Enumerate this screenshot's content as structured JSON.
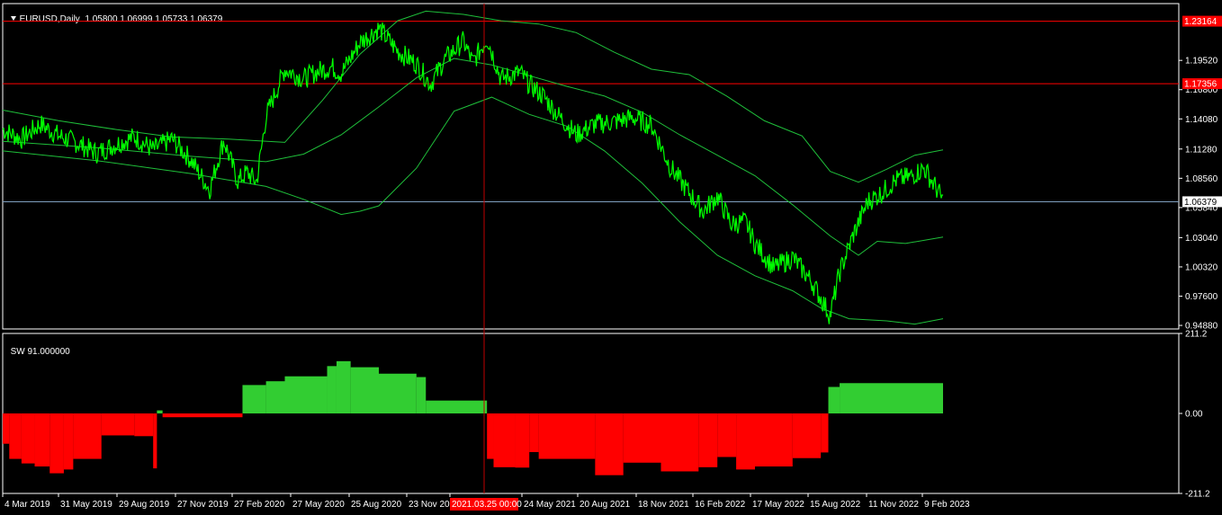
{
  "header": {
    "symbol": "EURUSD,Daily",
    "ohlc": "1.05800 1.06999 1.05733 1.06379",
    "indicator": "SW 91.000000"
  },
  "colors": {
    "background": "#000000",
    "price": "#00ff00",
    "bands": "#1fbf3a",
    "grid_frame": "#ffffff",
    "hline": "#ff0000",
    "positive": "#32cd32",
    "negative": "#ff0000",
    "crosshair": "#c00000",
    "current_price_line": "#7f9fbf"
  },
  "chart_data": [
    {
      "type": "line",
      "title": "EURUSD,Daily",
      "x_ticks": [
        "4 Mar 2019",
        "31 May 2019",
        "29 Aug 2019",
        "27 Nov 2019",
        "27 Feb 2020",
        "27 May 2020",
        "25 Aug 2020",
        "23 Nov 202",
        "2021.03.25 00:00",
        "24 May 2021",
        "20 Aug 2021",
        "18 Nov 2021",
        "16 Feb 2022",
        "17 May 2022",
        "15 Aug 2022",
        "11 Nov 2022",
        "9 Feb 2023"
      ],
      "y_ticks": [
        "1.19520",
        "1.16800",
        "1.14080",
        "1.11280",
        "1.08560",
        "1.05840",
        "1.03040",
        "1.00320",
        "0.97600",
        "0.94880"
      ],
      "ylim": [
        0.9455,
        1.248
      ],
      "h_levels": [
        {
          "label": "1.23164",
          "value": 1.23164
        },
        {
          "label": "1.17356",
          "value": 1.17356
        }
      ],
      "current_price": {
        "label": "1.06379",
        "value": 1.06379
      },
      "crosshair_date": "2021.03.25 00:00",
      "series": [
        {
          "role": "price",
          "x": [
            0,
            0.02,
            0.04,
            0.06,
            0.08,
            0.1,
            0.12,
            0.14,
            0.16,
            0.18,
            0.2,
            0.22,
            0.235,
            0.25,
            0.26,
            0.27,
            0.28,
            0.3,
            0.32,
            0.335,
            0.35,
            0.36,
            0.38,
            0.4,
            0.42,
            0.44,
            0.455,
            0.47,
            0.49,
            0.5,
            0.515,
            0.53,
            0.55,
            0.56,
            0.575,
            0.59,
            0.61,
            0.63,
            0.65,
            0.67,
            0.69,
            0.71,
            0.73,
            0.745,
            0.76,
            0.775,
            0.79,
            0.8,
            0.82,
            0.84,
            0.86,
            0.88,
            0.89,
            0.905,
            0.92,
            0.935,
            0.95,
            0.965,
            0.98,
            0.995,
            1.0
          ],
          "y": [
            1.131,
            1.122,
            1.136,
            1.125,
            1.118,
            1.109,
            1.117,
            1.124,
            1.112,
            1.122,
            1.103,
            1.075,
            1.121,
            1.083,
            1.091,
            1.082,
            1.143,
            1.187,
            1.178,
            1.185,
            1.189,
            1.183,
            1.212,
            1.225,
            1.204,
            1.192,
            1.173,
            1.196,
            1.213,
            1.193,
            1.216,
            1.178,
            1.184,
            1.173,
            1.162,
            1.145,
            1.126,
            1.136,
            1.138,
            1.142,
            1.135,
            1.096,
            1.072,
            1.055,
            1.069,
            1.043,
            1.045,
            1.025,
            1.002,
            1.012,
            0.99,
            0.958,
            0.998,
            1.034,
            1.064,
            1.072,
            1.084,
            1.087,
            1.095,
            1.073,
            1.064
          ]
        },
        {
          "role": "upper-band",
          "x": [
            0,
            0.06,
            0.12,
            0.18,
            0.24,
            0.3,
            0.34,
            0.38,
            0.42,
            0.45,
            0.49,
            0.53,
            0.57,
            0.61,
            0.65,
            0.69,
            0.73,
            0.77,
            0.81,
            0.85,
            0.88,
            0.91,
            0.94,
            0.97,
            1.0
          ],
          "y": [
            1.149,
            1.139,
            1.131,
            1.124,
            1.122,
            1.119,
            1.158,
            1.201,
            1.232,
            1.241,
            1.238,
            1.232,
            1.229,
            1.221,
            1.203,
            1.187,
            1.182,
            1.162,
            1.139,
            1.125,
            1.092,
            1.082,
            1.094,
            1.107,
            1.112
          ]
        },
        {
          "role": "middle-band",
          "x": [
            0,
            0.1,
            0.2,
            0.28,
            0.32,
            0.36,
            0.4,
            0.44,
            0.48,
            0.52,
            0.56,
            0.6,
            0.64,
            0.68,
            0.72,
            0.76,
            0.8,
            0.84,
            0.88,
            0.91,
            0.93,
            0.96,
            1.0
          ],
          "y": [
            1.12,
            1.114,
            1.106,
            1.101,
            1.108,
            1.126,
            1.152,
            1.179,
            1.197,
            1.191,
            1.181,
            1.171,
            1.162,
            1.147,
            1.126,
            1.107,
            1.088,
            1.061,
            1.032,
            1.014,
            1.027,
            1.025,
            1.031
          ]
        },
        {
          "role": "lower-band",
          "x": [
            0,
            0.1,
            0.2,
            0.28,
            0.32,
            0.36,
            0.38,
            0.4,
            0.44,
            0.48,
            0.52,
            0.56,
            0.6,
            0.64,
            0.68,
            0.72,
            0.76,
            0.8,
            0.84,
            0.87,
            0.9,
            0.94,
            0.97,
            1.0
          ],
          "y": [
            1.111,
            1.102,
            1.09,
            1.078,
            1.066,
            1.052,
            1.055,
            1.06,
            1.095,
            1.148,
            1.161,
            1.145,
            1.134,
            1.111,
            1.081,
            1.045,
            1.014,
            0.995,
            0.981,
            0.965,
            0.955,
            0.953,
            0.95,
            0.955
          ]
        }
      ]
    },
    {
      "type": "bar",
      "title": "SW 91.000000",
      "ylim": [
        -211.2,
        211.2
      ],
      "y_ticks": [
        "211.2",
        "0.00",
        "-211.2"
      ],
      "segments": [
        {
          "x": [
            0.0,
            0.007
          ],
          "v": -80
        },
        {
          "x": [
            0.007,
            0.02
          ],
          "v": -120
        },
        {
          "x": [
            0.02,
            0.034
          ],
          "v": -132
        },
        {
          "x": [
            0.034,
            0.05
          ],
          "v": -140
        },
        {
          "x": [
            0.05,
            0.065
          ],
          "v": -158
        },
        {
          "x": [
            0.065,
            0.075
          ],
          "v": -148
        },
        {
          "x": [
            0.075,
            0.105
          ],
          "v": -120
        },
        {
          "x": [
            0.105,
            0.14
          ],
          "v": -58
        },
        {
          "x": [
            0.14,
            0.16
          ],
          "v": -60
        },
        {
          "x": [
            0.16,
            0.164
          ],
          "v": -145
        },
        {
          "x": [
            0.164,
            0.17
          ],
          "v": 8
        },
        {
          "x": [
            0.17,
            0.255
          ],
          "v": -10
        },
        {
          "x": [
            0.255,
            0.28
          ],
          "v": 75
        },
        {
          "x": [
            0.28,
            0.3
          ],
          "v": 85
        },
        {
          "x": [
            0.3,
            0.345
          ],
          "v": 98
        },
        {
          "x": [
            0.345,
            0.355
          ],
          "v": 125
        },
        {
          "x": [
            0.355,
            0.37
          ],
          "v": 138
        },
        {
          "x": [
            0.37,
            0.4
          ],
          "v": 122
        },
        {
          "x": [
            0.4,
            0.44
          ],
          "v": 105
        },
        {
          "x": [
            0.44,
            0.45
          ],
          "v": 96
        },
        {
          "x": [
            0.45,
            0.515
          ],
          "v": 34
        },
        {
          "x": [
            0.515,
            0.522
          ],
          "v": -120
        },
        {
          "x": [
            0.522,
            0.545
          ],
          "v": -142
        },
        {
          "x": [
            0.545,
            0.56
          ],
          "v": -143
        },
        {
          "x": [
            0.56,
            0.57
          ],
          "v": -102
        },
        {
          "x": [
            0.57,
            0.63
          ],
          "v": -120
        },
        {
          "x": [
            0.63,
            0.66
          ],
          "v": -163
        },
        {
          "x": [
            0.66,
            0.7
          ],
          "v": -130
        },
        {
          "x": [
            0.7,
            0.74
          ],
          "v": -153
        },
        {
          "x": [
            0.74,
            0.76
          ],
          "v": -142
        },
        {
          "x": [
            0.76,
            0.78
          ],
          "v": -115
        },
        {
          "x": [
            0.78,
            0.8
          ],
          "v": -148
        },
        {
          "x": [
            0.8,
            0.84
          ],
          "v": -140
        },
        {
          "x": [
            0.84,
            0.87
          ],
          "v": -118
        },
        {
          "x": [
            0.87,
            0.878
          ],
          "v": -103
        },
        {
          "x": [
            0.878,
            0.89
          ],
          "v": 70
        },
        {
          "x": [
            0.89,
            1.0
          ],
          "v": 80
        }
      ]
    }
  ]
}
